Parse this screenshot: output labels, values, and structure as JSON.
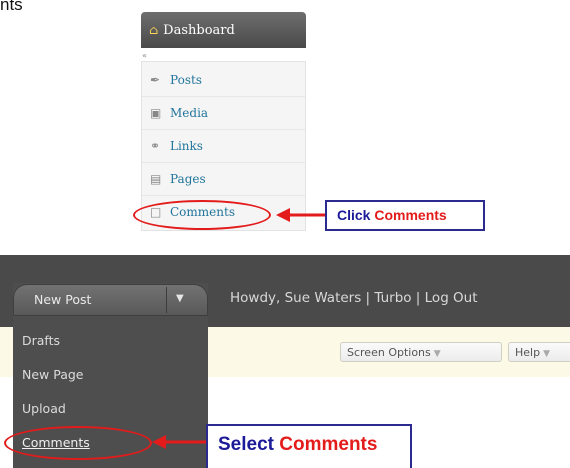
{
  "corner_text": "nts",
  "wp_sidebar": {
    "header": "Dashboard",
    "collapse_glyph": "«",
    "items": [
      {
        "label": "Posts",
        "icon": "pin-icon"
      },
      {
        "label": "Media",
        "icon": "media-icon"
      },
      {
        "label": "Links",
        "icon": "link-icon"
      },
      {
        "label": "Pages",
        "icon": "pages-icon"
      },
      {
        "label": "Comments",
        "icon": "comment-icon"
      }
    ]
  },
  "callout1": {
    "prefix": "Click ",
    "highlight": "Comments"
  },
  "admin_bar": {
    "howdy": "Howdy, Sue Waters | Turbo | Log Out",
    "screen_options": "Screen Options",
    "help": "Help"
  },
  "favorites": {
    "selected": "New Post",
    "items": [
      "Drafts",
      "New Page",
      "Upload",
      "Comments"
    ]
  },
  "callout2": {
    "prefix": "Select ",
    "highlight": "Comments"
  },
  "colors": {
    "annotation_red": "#e31b1b",
    "annotation_blue": "#1b1b9a",
    "link_blue": "#21759b",
    "admin_bar_dark": "#4a4a4a"
  }
}
